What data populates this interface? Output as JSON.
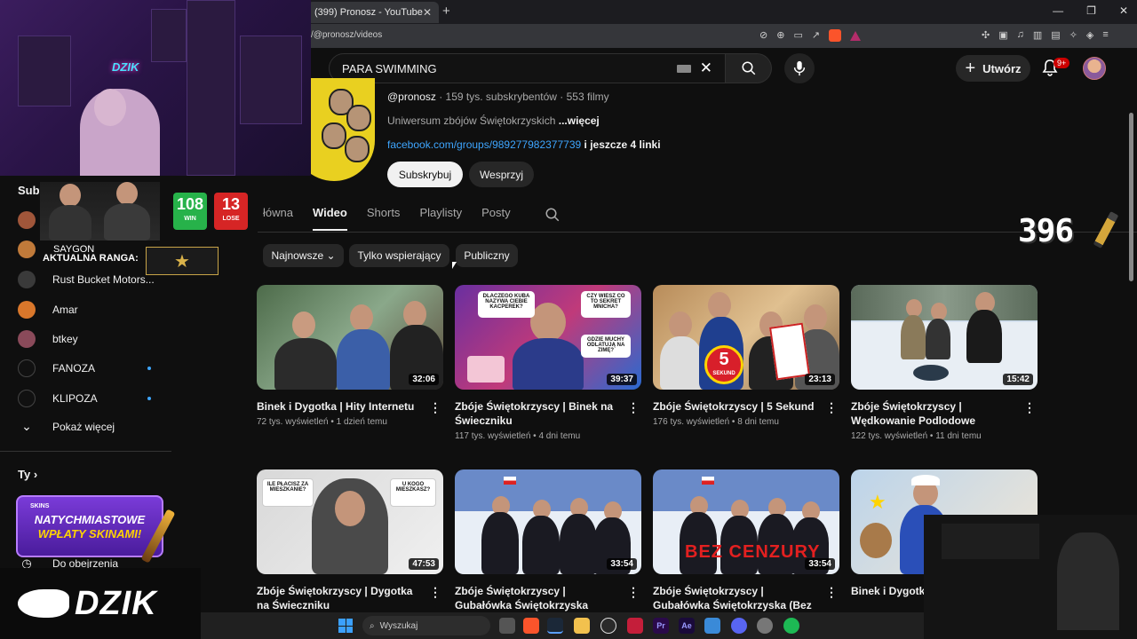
{
  "browser": {
    "tab_title": "(399) Pronosz - YouTube",
    "tab_close": "✕",
    "new_tab": "+",
    "url": "/@pronosz/videos"
  },
  "header": {
    "search_value": "PARA SWIMMING",
    "create_label": "Utwórz",
    "notifications_badge": "9+"
  },
  "channel": {
    "handle": "@pronosz",
    "stats": " · 159 tys. subskrybentów · 553 filmy",
    "description": "Uniwersum zbójów Świętokrzyskich ",
    "more": "...więcej",
    "link": "facebook.com/groups/989277982377739",
    "more_links": " i jeszcze 4 linki",
    "subscribe": "Subskrybuj",
    "join": "Wesprzyj"
  },
  "tabs": [
    "łówna",
    "Wideo",
    "Shorts",
    "Playlisty",
    "Posty"
  ],
  "chips": [
    "Najnowsze",
    "Tylko wspierający",
    "Publiczny"
  ],
  "videos": [
    {
      "title": "Binek i Dygotka | Hity Internetu",
      "meta": "72 tys. wyświetleń • 1 dzień temu",
      "duration": "32:06"
    },
    {
      "title": "Zbóje Świętokrzyscy | Binek na Świeczniku",
      "meta": "117 tys. wyświetleń • 4 dni temu",
      "duration": "39:37"
    },
    {
      "title": "Zbóje Świętokrzyscy | 5 Sekund",
      "meta": "176 tys. wyświetleń • 8 dni temu",
      "duration": "23:13"
    },
    {
      "title": "Zbóje Świętokrzyscy | Wędkowanie Podlodowe",
      "meta": "122 tys. wyświetleń • 11 dni temu",
      "duration": "15:42"
    },
    {
      "title": "Zbóje Świętokrzyscy | Dygotka na Świeczniku",
      "meta": "",
      "duration": "47:53"
    },
    {
      "title": "Zbóje Świętokrzyscy | Gubałówka Świętokrzyska",
      "meta": "",
      "duration": "33:54"
    },
    {
      "title": "Zbóje Świętokrzyscy | Gubałówka Świętokrzyska (Bez Cenzury !!)",
      "meta": "",
      "duration": "33:54"
    },
    {
      "title": "Binek i Dygotka Rodzicielski cz.",
      "meta": "",
      "duration": ""
    }
  ],
  "thumb_text": {
    "kacperek": "DLACZEGO KUBA NAZYWA CIEBIE KACPEREK?",
    "sekret": "CZY WIESZ CO TO SEKRET MNICHA?",
    "muchy": "GDZIE MUCHY ODLATUJĄ NA ZIMĘ?",
    "placisz": "ILE PŁACISZ ZA MIESZKANIE?",
    "mieszkasz": "U KOGO MIESZKASZ?",
    "five": "5",
    "sekund": "SEKUND",
    "bez_cenzury": "BEZ CENZURY"
  },
  "sidebar": {
    "subs_label": "Subs",
    "items": [
      {
        "label": "Rust Bucket Motors...",
        "color": "#3a3a3a"
      },
      {
        "label": "Amar",
        "color": "#d9772b"
      },
      {
        "label": "btkey",
        "color": "#8a4a5a"
      },
      {
        "label": "FANOZA",
        "color": "#111111"
      },
      {
        "label": "KLIPOZA",
        "color": "#111111"
      }
    ],
    "show_more": "Pokaż więcej",
    "you": "Ty",
    "watch_later": "Do obejrzenia"
  },
  "overlay": {
    "win": "108",
    "win_label": "WIN",
    "lose": "13",
    "lose_label": "LOSE",
    "player": "SAYGON",
    "rank_label": "AKTUALNA RANGA:",
    "counter": "396",
    "promo_brand": "SKINS",
    "promo_line1": "NATYCHMIASTOWE",
    "promo_line2": "WPŁATY SKINAMI!",
    "banner": "DZIK",
    "neon": "DZIK"
  },
  "taskbar": {
    "search": "Wyszukaj"
  },
  "colors": {
    "accent_link": "#3ea6ff",
    "win": "#27b24a",
    "lose": "#d62525"
  }
}
